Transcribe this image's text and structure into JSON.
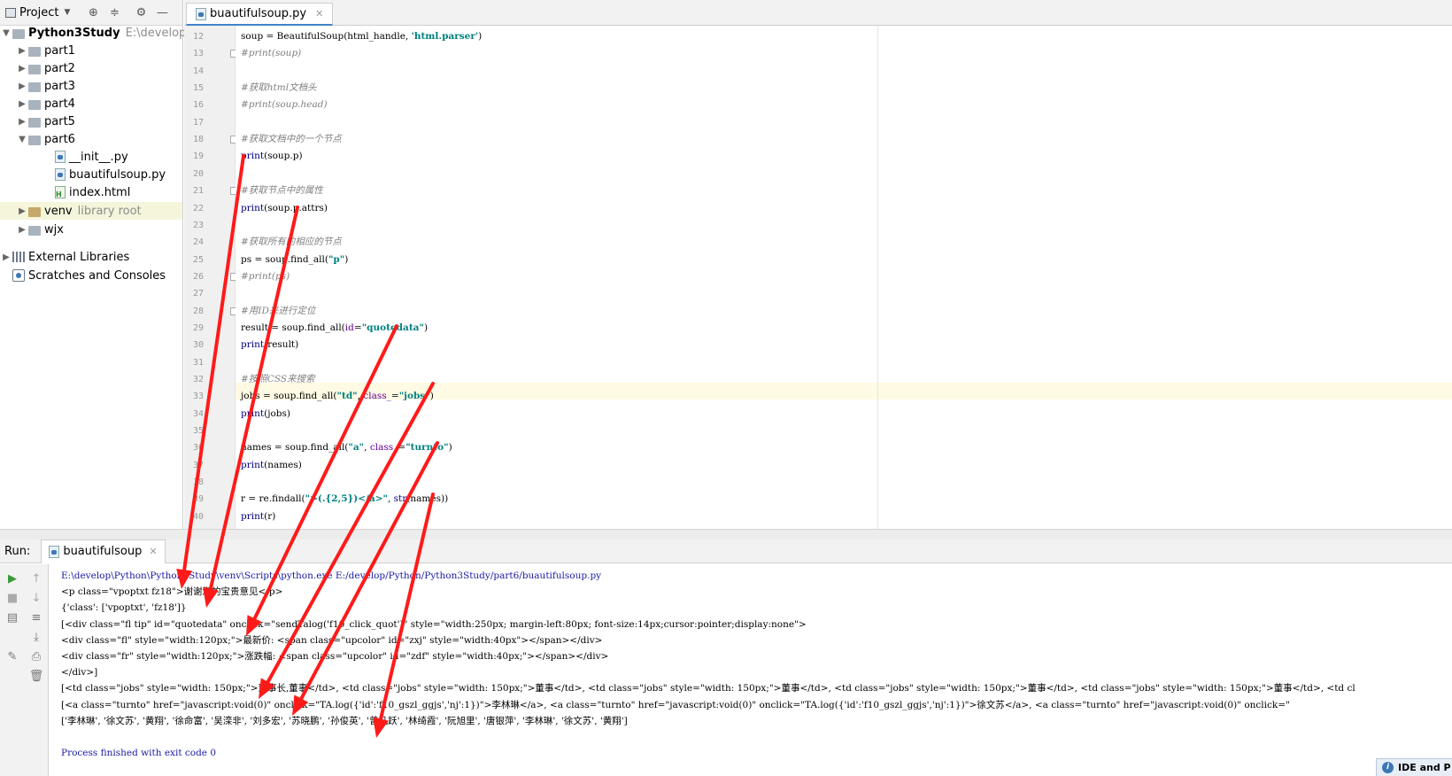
{
  "project_panel": {
    "title": "Project",
    "root": {
      "name": "Python3Study",
      "path": "E:\\develop\\Py"
    },
    "items": [
      {
        "label": "part1"
      },
      {
        "label": "part2"
      },
      {
        "label": "part3"
      },
      {
        "label": "part4"
      },
      {
        "label": "part5"
      },
      {
        "label": "part6"
      },
      {
        "label": "__init__.py"
      },
      {
        "label": "buautifulsoup.py"
      },
      {
        "label": "index.html"
      },
      {
        "label": "venv",
        "note": "library root"
      },
      {
        "label": "wjx"
      },
      {
        "label": "External Libraries"
      },
      {
        "label": "Scratches and Consoles"
      }
    ]
  },
  "editor": {
    "tab": "buautifulsoup.py",
    "line_numbers": [
      "12",
      "13",
      "14",
      "15",
      "16",
      "17",
      "18",
      "19",
      "20",
      "21",
      "22",
      "23",
      "24",
      "25",
      "26",
      "27",
      "28",
      "29",
      "30",
      "31",
      "32",
      "33",
      "34",
      "35",
      "36",
      "37",
      "38",
      "39",
      "40"
    ],
    "lines": [
      {
        "parts": [
          {
            "t": "soup = BeautifulSoup(html_handle, "
          },
          {
            "t": "'html.parser'",
            "c": "st"
          },
          {
            "t": ")"
          }
        ]
      },
      {
        "parts": [
          {
            "t": "#print(soup)",
            "c": "cm"
          }
        ]
      },
      {
        "parts": []
      },
      {
        "parts": [
          {
            "t": "#获取html文档头",
            "c": "cm"
          }
        ]
      },
      {
        "parts": [
          {
            "t": "#print(soup.head)",
            "c": "cm"
          }
        ]
      },
      {
        "parts": []
      },
      {
        "parts": [
          {
            "t": "#获取文档中的一个节点",
            "c": "cm"
          }
        ]
      },
      {
        "parts": [
          {
            "t": "print",
            "c": "kw"
          },
          {
            "t": "(soup.p)"
          }
        ]
      },
      {
        "parts": []
      },
      {
        "parts": [
          {
            "t": "#获取节点中的属性",
            "c": "cm"
          }
        ]
      },
      {
        "parts": [
          {
            "t": "print",
            "c": "kw"
          },
          {
            "t": "(soup.p.attrs)"
          }
        ]
      },
      {
        "parts": []
      },
      {
        "parts": [
          {
            "t": "#获取所有的相应的节点",
            "c": "cm"
          }
        ]
      },
      {
        "parts": [
          {
            "t": "ps = soup.find_all("
          },
          {
            "t": "\"p\"",
            "c": "st"
          },
          {
            "t": ")"
          }
        ]
      },
      {
        "parts": [
          {
            "t": "#print(ps)",
            "c": "cm"
          }
        ]
      },
      {
        "parts": []
      },
      {
        "parts": [
          {
            "t": "#用ID来进行定位",
            "c": "cm"
          }
        ]
      },
      {
        "parts": [
          {
            "t": "result = soup.find_all("
          },
          {
            "t": "id",
            "c": "named"
          },
          {
            "t": "="
          },
          {
            "t": "\"quotedata\"",
            "c": "st"
          },
          {
            "t": ")"
          }
        ]
      },
      {
        "parts": [
          {
            "t": "print",
            "c": "kw"
          },
          {
            "t": "(result)"
          }
        ]
      },
      {
        "parts": []
      },
      {
        "parts": [
          {
            "t": "#按照CSS来搜索",
            "c": "cm"
          }
        ]
      },
      {
        "parts": [
          {
            "t": "jobs = soup.find_all("
          },
          {
            "t": "\"td\"",
            "c": "st"
          },
          {
            "t": ", "
          },
          {
            "t": "class_",
            "c": "named"
          },
          {
            "t": "="
          },
          {
            "t": "\"jobs\"",
            "c": "st"
          },
          {
            "t": ")"
          }
        ]
      },
      {
        "parts": [
          {
            "t": "print",
            "c": "kw"
          },
          {
            "t": "(jobs)"
          }
        ]
      },
      {
        "parts": []
      },
      {
        "parts": [
          {
            "t": "names = soup.find_all("
          },
          {
            "t": "\"a\"",
            "c": "st"
          },
          {
            "t": ", "
          },
          {
            "t": "class_",
            "c": "named"
          },
          {
            "t": "="
          },
          {
            "t": "\"turnto\"",
            "c": "st"
          },
          {
            "t": ")"
          }
        ]
      },
      {
        "parts": [
          {
            "t": "print",
            "c": "kw"
          },
          {
            "t": "(names)"
          }
        ]
      },
      {
        "parts": []
      },
      {
        "parts": [
          {
            "t": "r = re.findall("
          },
          {
            "t": "\">(.{2,5})</a>\"",
            "c": "st"
          },
          {
            "t": ", "
          },
          {
            "t": "str",
            "c": "kw"
          },
          {
            "t": "(names))"
          }
        ]
      },
      {
        "parts": [
          {
            "t": "print",
            "c": "kw"
          },
          {
            "t": "(r)"
          }
        ]
      }
    ]
  },
  "run_panel": {
    "label": "Run:",
    "tab": "buautifulsoup",
    "output": [
      {
        "t": "E:\\develop\\Python\\Python3Study\\venv\\Scripts\\python.exe E:/develop/Python/Python3Study/part6/buautifulsoup.py",
        "c": "blue"
      },
      {
        "t": "<p class=\"vpoptxt fz18\">谢谢您的宝贵意见</p>"
      },
      {
        "t": "{'class': ['vpoptxt', 'fz18']}"
      },
      {
        "t": "[<div class=\"fl tip\" id=\"quotedata\" onclick=\"sendTalog('f10_click_quot')\" style=\"width:250px; margin-left:80px; font-size:14px;cursor:pointer;display:none\">"
      },
      {
        "t": "<div class=\"fl\" style=\"width:120px;\">最新价: <span class=\"upcolor\" id=\"zxj\" style=\"width:40px\"></span></div>"
      },
      {
        "t": "<div class=\"fr\" style=\"width:120px;\">涨跌幅: <span class=\"upcolor\" id=\"zdf\" style=\"width:40px;\"></span></div>"
      },
      {
        "t": "</div>]"
      },
      {
        "t": "[<td class=\"jobs\" style=\"width: 150px;\">董事长,董事</td>, <td class=\"jobs\" style=\"width: 150px;\">董事</td>, <td class=\"jobs\" style=\"width: 150px;\">董事</td>, <td class=\"jobs\" style=\"width: 150px;\">董事</td>, <td class=\"jobs\" style=\"width: 150px;\">董事</td>, <td cl"
      },
      {
        "t": "[<a class=\"turnto\" href=\"javascript:void(0)\" onclick=\"TA.log({'id':'f10_gszl_ggjs','nj':1})\">李林琳</a>, <a class=\"turnto\" href=\"javascript:void(0)\" onclick=\"TA.log({'id':'f10_gszl_ggjs','nj':1})\">徐文苏</a>, <a class=\"turnto\" href=\"javascript:void(0)\" onclick=\""
      },
      {
        "t": "['李林琳', '徐文苏', '黄翔', '徐命富', '吴滦非', '刘多宏', '苏晓鹏', '孙俊英', '曾凡跃', '林绮霞', '阮旭里', '唐银萍', '李林琳', '徐文苏', '黄翔']"
      },
      {
        "t": ""
      },
      {
        "t": "Process finished with exit code 0",
        "c": "blue"
      }
    ]
  },
  "notification": {
    "label": "IDE and P"
  },
  "icons": [
    "project-view-icon",
    "dropdown-icon",
    "locate-icon",
    "collapse-icon",
    "settings-icon",
    "minimize-icon",
    "run-icon",
    "stop-icon",
    "up-icon",
    "down-icon",
    "layout-icon",
    "wrap-icon",
    "scroll-icon",
    "pin-icon",
    "print-icon",
    "trash-icon",
    "info-icon"
  ],
  "colors": {
    "annotation_arrow": "#ff1a1a",
    "current_line": "#fffae3",
    "tab_underline": "#4083c9"
  }
}
